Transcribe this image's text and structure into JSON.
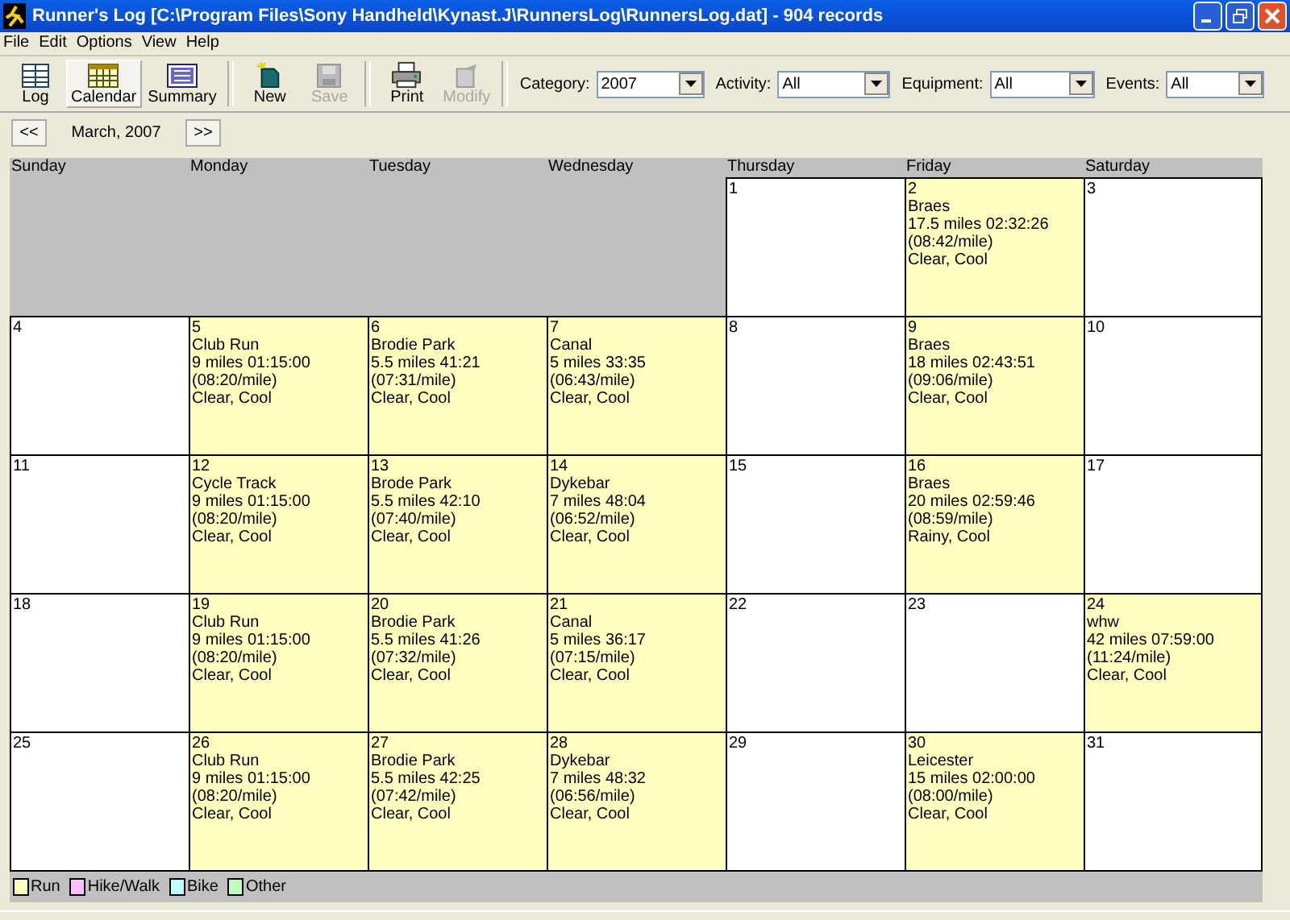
{
  "window": {
    "title": "Runner's Log [C:\\Program Files\\Sony Handheld\\Kynast.J\\RunnersLog\\RunnersLog.dat] - 904 records"
  },
  "menu": [
    "File",
    "Edit",
    "Options",
    "View",
    "Help"
  ],
  "toolbar": [
    {
      "label": "Log",
      "selected": false,
      "disabled": false
    },
    {
      "label": "Calendar",
      "selected": true,
      "disabled": false
    },
    {
      "label": "Summary",
      "selected": false,
      "disabled": false
    },
    {
      "label": "New",
      "selected": false,
      "disabled": false
    },
    {
      "label": "Save",
      "selected": false,
      "disabled": true
    },
    {
      "label": "Print",
      "selected": false,
      "disabled": false
    },
    {
      "label": "Modify",
      "selected": false,
      "disabled": true
    }
  ],
  "filters": [
    {
      "label": "Category:",
      "value": "2007"
    },
    {
      "label": "Activity:",
      "value": "All"
    },
    {
      "label": "Equipment:",
      "value": "All"
    },
    {
      "label": "Events:",
      "value": "All"
    }
  ],
  "nav": {
    "prev": "<<",
    "month": "March, 2007",
    "next": ">>"
  },
  "weekdays": [
    "Sunday",
    "Monday",
    "Tuesday",
    "Wednesday",
    "Thursday",
    "Friday",
    "Saturday"
  ],
  "weeks": [
    [
      {
        "day": "1"
      },
      {
        "day": "2",
        "kind": "run",
        "lines": [
          "Braes",
          "17.5 miles 02:32:26",
          "(08:42/mile)",
          "Clear, Cool"
        ]
      },
      {
        "day": "3"
      }
    ],
    [
      {
        "day": "4"
      },
      {
        "day": "5",
        "kind": "run",
        "lines": [
          "Club Run",
          "9 miles 01:15:00",
          "(08:20/mile)",
          "Clear, Cool"
        ]
      },
      {
        "day": "6",
        "kind": "run",
        "lines": [
          "Brodie Park",
          "5.5 miles 41:21",
          "(07:31/mile)",
          "Clear, Cool"
        ]
      },
      {
        "day": "7",
        "kind": "run",
        "lines": [
          "Canal",
          "5 miles 33:35",
          "(06:43/mile)",
          "Clear, Cool"
        ]
      },
      {
        "day": "8"
      },
      {
        "day": "9",
        "kind": "run",
        "lines": [
          "Braes",
          "18 miles 02:43:51",
          "(09:06/mile)",
          "Clear, Cool"
        ]
      },
      {
        "day": "10"
      }
    ],
    [
      {
        "day": "11"
      },
      {
        "day": "12",
        "kind": "run",
        "lines": [
          "Cycle Track",
          "9 miles 01:15:00",
          "(08:20/mile)",
          "Clear, Cool"
        ]
      },
      {
        "day": "13",
        "kind": "run",
        "lines": [
          "Brode Park",
          "5.5 miles 42:10",
          "(07:40/mile)",
          "Clear, Cool"
        ]
      },
      {
        "day": "14",
        "kind": "run",
        "lines": [
          "Dykebar",
          "7 miles 48:04",
          "(06:52/mile)",
          "Clear, Cool"
        ]
      },
      {
        "day": "15"
      },
      {
        "day": "16",
        "kind": "run",
        "lines": [
          "Braes",
          "20 miles 02:59:46",
          "(08:59/mile)",
          "Rainy, Cool"
        ]
      },
      {
        "day": "17"
      }
    ],
    [
      {
        "day": "18"
      },
      {
        "day": "19",
        "kind": "run",
        "lines": [
          "Club Run",
          "9 miles 01:15:00",
          "(08:20/mile)",
          "Clear, Cool"
        ]
      },
      {
        "day": "20",
        "kind": "run",
        "lines": [
          "Brodie Park",
          "5.5 miles 41:26",
          "(07:32/mile)",
          "Clear, Cool"
        ]
      },
      {
        "day": "21",
        "kind": "run",
        "lines": [
          "Canal",
          "5 miles 36:17",
          "(07:15/mile)",
          "Clear, Cool"
        ]
      },
      {
        "day": "22"
      },
      {
        "day": "23"
      },
      {
        "day": "24",
        "kind": "run",
        "lines": [
          "whw",
          "42 miles 07:59:00",
          "(11:24/mile)",
          "Clear, Cool"
        ]
      }
    ],
    [
      {
        "day": "25"
      },
      {
        "day": "26",
        "kind": "run",
        "lines": [
          "Club Run",
          "9 miles 01:15:00",
          "(08:20/mile)",
          "Clear, Cool"
        ]
      },
      {
        "day": "27",
        "kind": "run",
        "lines": [
          "Brodie Park",
          "5.5 miles 42:25",
          "(07:42/mile)",
          "Clear, Cool"
        ]
      },
      {
        "day": "28",
        "kind": "run",
        "lines": [
          "Dykebar",
          "7 miles 48:32",
          "(06:56/mile)",
          "Clear, Cool"
        ]
      },
      {
        "day": "29"
      },
      {
        "day": "30",
        "kind": "run",
        "lines": [
          "Leicester",
          "15 miles 02:00:00",
          "(08:00/mile)",
          "Clear, Cool"
        ]
      },
      {
        "day": "31"
      }
    ]
  ],
  "legend": [
    {
      "label": "Run",
      "color": "#ffffc0"
    },
    {
      "label": "Hike/Walk",
      "color": "#ffc0ff"
    },
    {
      "label": "Bike",
      "color": "#c0ffff"
    },
    {
      "label": "Other",
      "color": "#c0ffc0"
    }
  ]
}
